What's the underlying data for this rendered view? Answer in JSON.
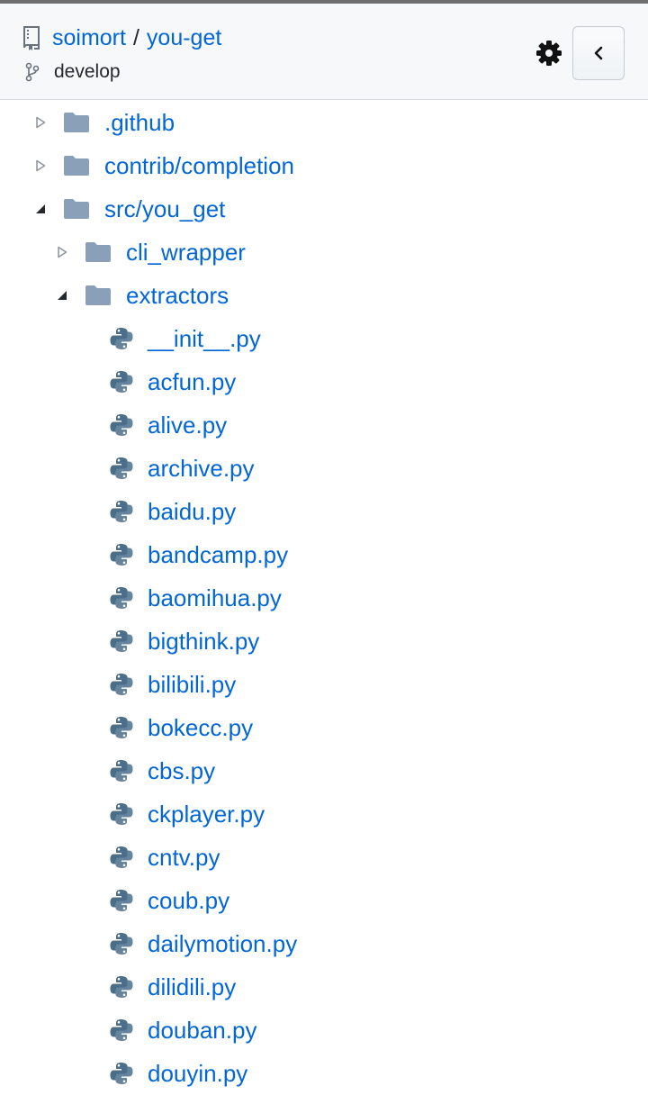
{
  "header": {
    "owner": "soimort",
    "separator": "/",
    "repo": "you-get",
    "branch": "develop",
    "icons": {
      "repo": "repo-icon",
      "branch": "git-branch-icon",
      "settings": "gear-icon",
      "collapse": "chevron-left-icon"
    }
  },
  "tree": [
    {
      "label": ".github",
      "type": "folder",
      "state": "collapsed",
      "depth": 0
    },
    {
      "label": "contrib/completion",
      "type": "folder",
      "state": "collapsed",
      "depth": 0
    },
    {
      "label": "src/you_get",
      "type": "folder",
      "state": "expanded",
      "depth": 0
    },
    {
      "label": "cli_wrapper",
      "type": "folder",
      "state": "collapsed",
      "depth": 1
    },
    {
      "label": "extractors",
      "type": "folder",
      "state": "expanded",
      "depth": 1
    },
    {
      "label": "__init__.py",
      "type": "python-file",
      "depth": 2
    },
    {
      "label": "acfun.py",
      "type": "python-file",
      "depth": 2
    },
    {
      "label": "alive.py",
      "type": "python-file",
      "depth": 2
    },
    {
      "label": "archive.py",
      "type": "python-file",
      "depth": 2
    },
    {
      "label": "baidu.py",
      "type": "python-file",
      "depth": 2
    },
    {
      "label": "bandcamp.py",
      "type": "python-file",
      "depth": 2
    },
    {
      "label": "baomihua.py",
      "type": "python-file",
      "depth": 2
    },
    {
      "label": "bigthink.py",
      "type": "python-file",
      "depth": 2
    },
    {
      "label": "bilibili.py",
      "type": "python-file",
      "depth": 2
    },
    {
      "label": "bokecc.py",
      "type": "python-file",
      "depth": 2
    },
    {
      "label": "cbs.py",
      "type": "python-file",
      "depth": 2
    },
    {
      "label": "ckplayer.py",
      "type": "python-file",
      "depth": 2
    },
    {
      "label": "cntv.py",
      "type": "python-file",
      "depth": 2
    },
    {
      "label": "coub.py",
      "type": "python-file",
      "depth": 2
    },
    {
      "label": "dailymotion.py",
      "type": "python-file",
      "depth": 2
    },
    {
      "label": "dilidili.py",
      "type": "python-file",
      "depth": 2
    },
    {
      "label": "douban.py",
      "type": "python-file",
      "depth": 2
    },
    {
      "label": "douyin.py",
      "type": "python-file",
      "depth": 2
    }
  ],
  "colors": {
    "link": "#0366d6",
    "folder": "#8aa0b9",
    "python": "#4b6e8a",
    "header_bg": "#f6f8fa"
  }
}
